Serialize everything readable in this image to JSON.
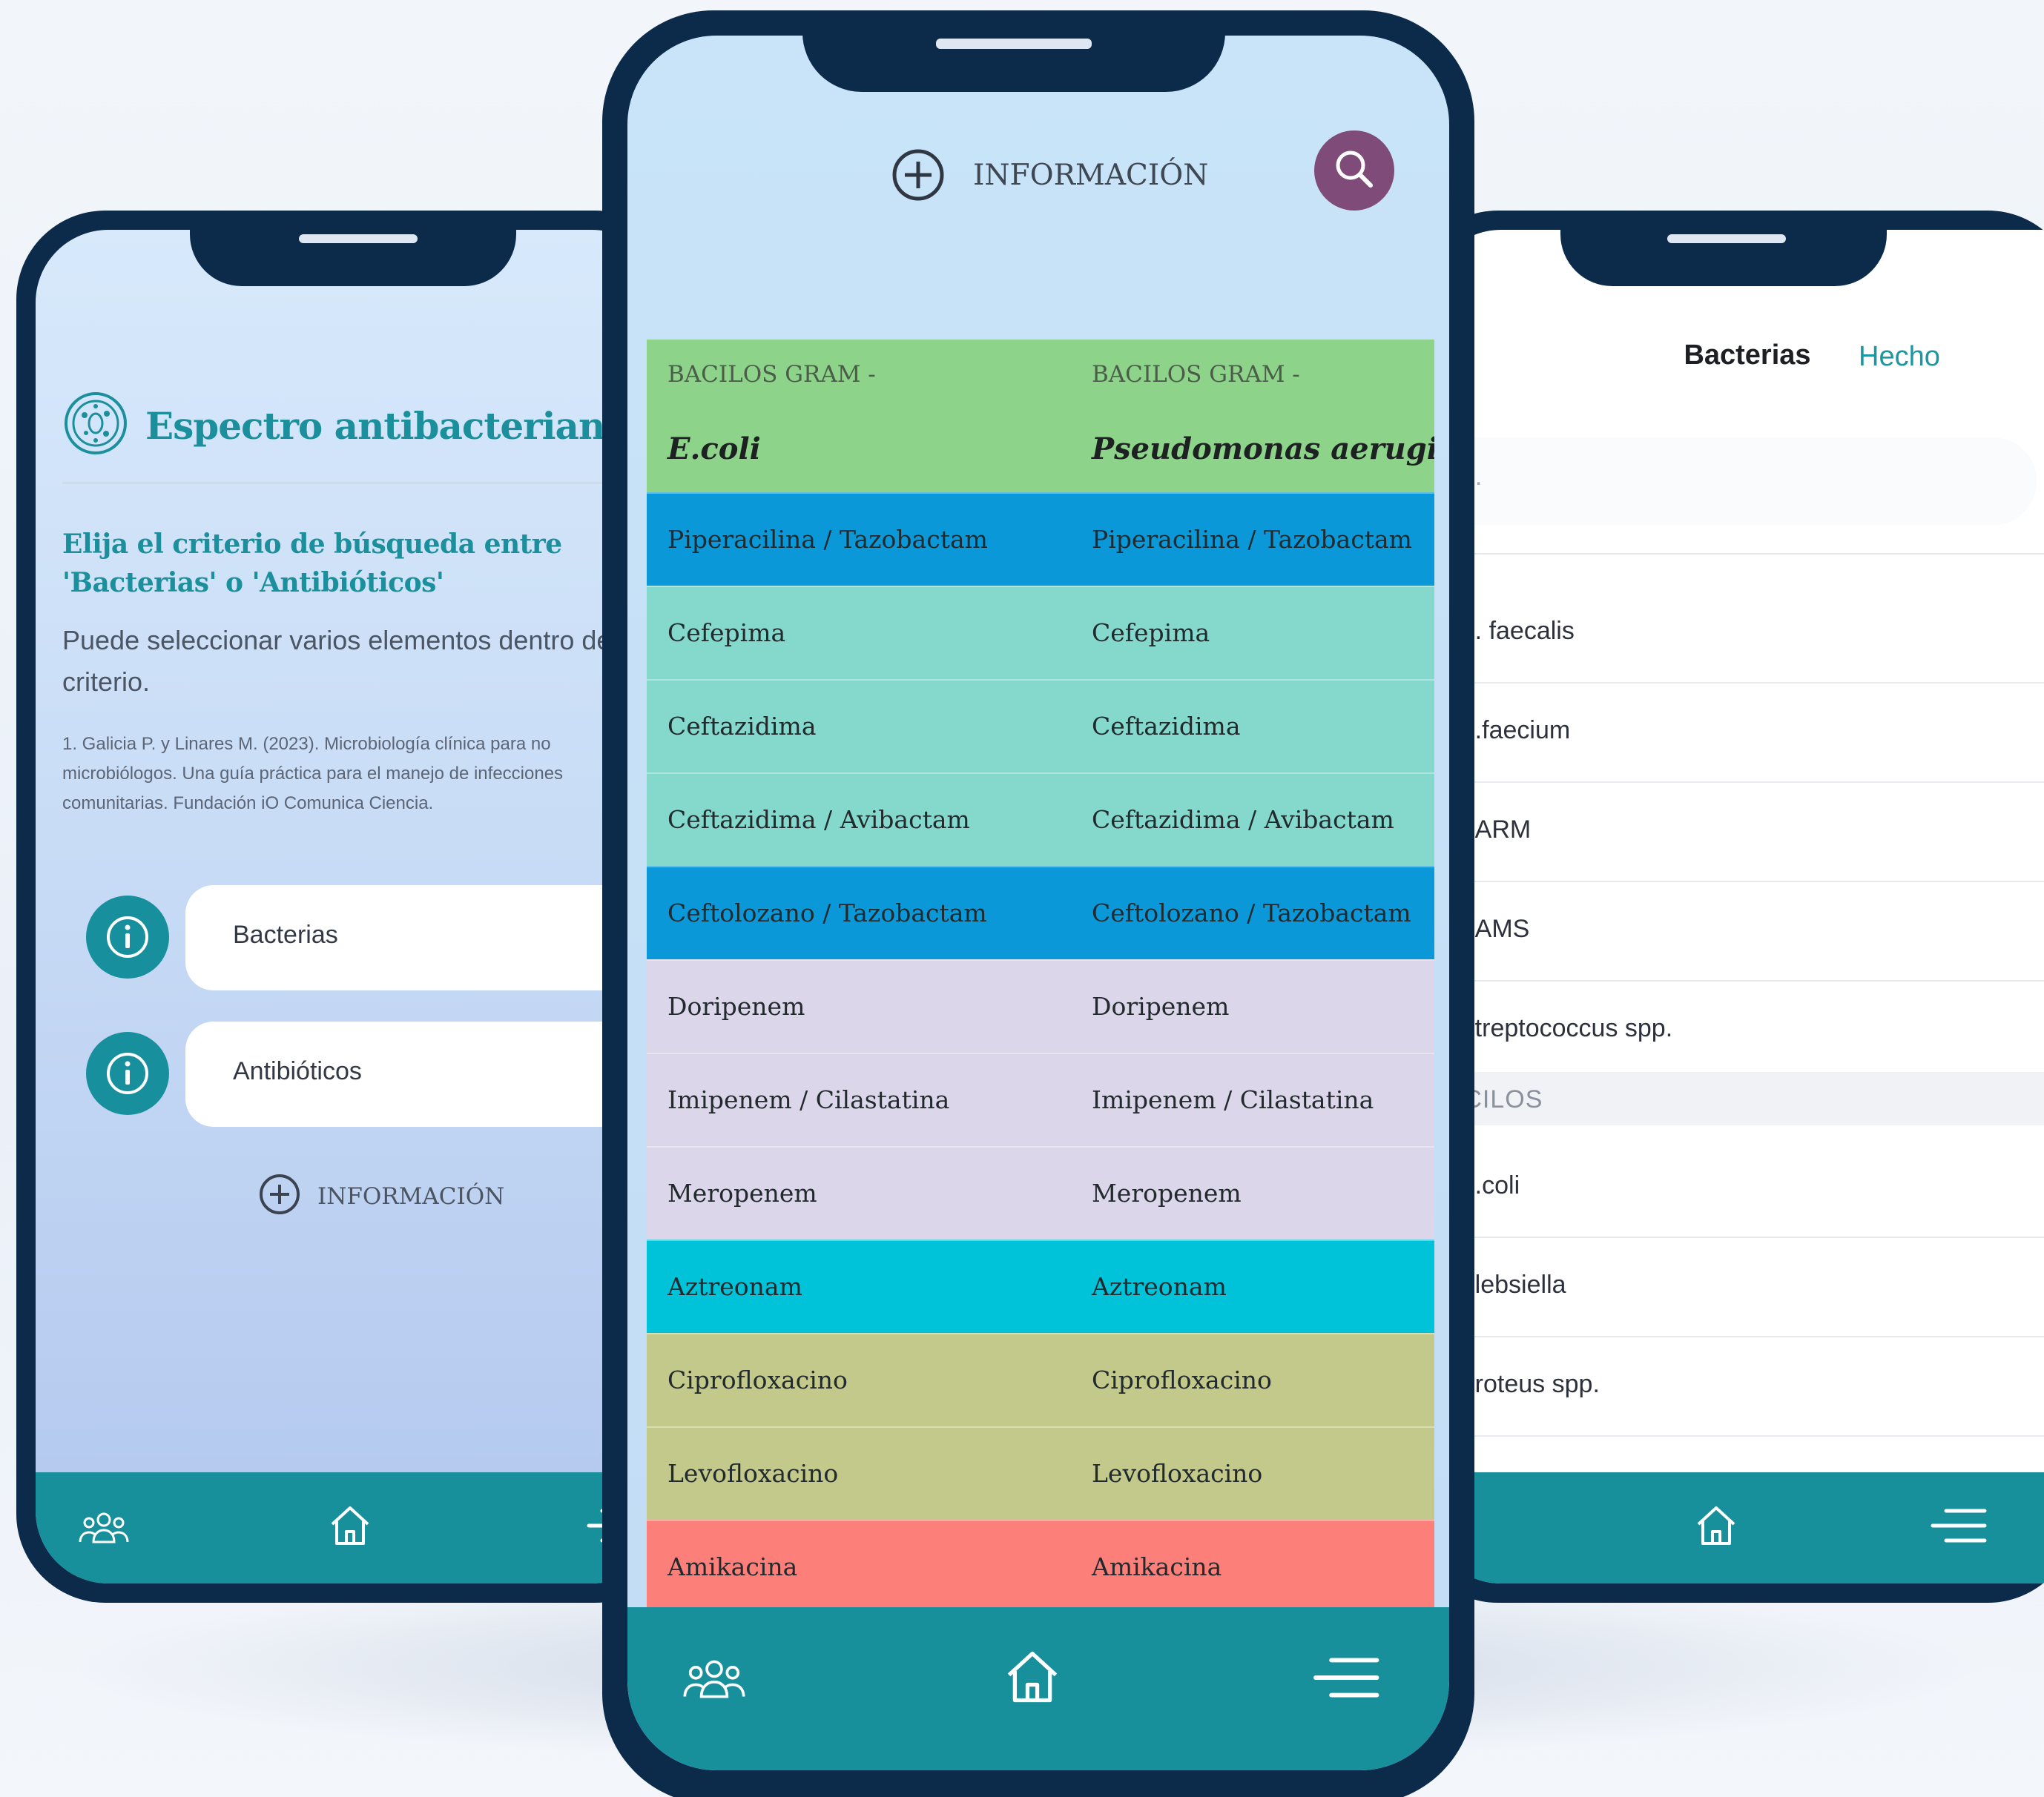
{
  "left": {
    "title": "Espectro antibacteriano",
    "title_sup": "1",
    "lead": "Elija el criterio de búsqueda entre 'Bacterias' o 'Antibióticos'",
    "description": "Puede seleccionar varios elementos dentro del criterio.",
    "reference": "1. Galicia P. y Linares M. (2023). Microbiología clínica para no microbiólogos. Una guía práctica para el manejo de infecciones comunitarias. Fundación iO Comunica Ciencia.",
    "options": [
      {
        "label": "Bacterias"
      },
      {
        "label": "Antibióticos"
      }
    ],
    "info_label": "INFORMACIÓN"
  },
  "center": {
    "info_label": "INFORMACIÓN",
    "columns": [
      {
        "group": "BACILOS GRAM -",
        "bacteria": "E.coli"
      },
      {
        "group": "BACILOS GRAM -",
        "bacteria": "Pseudomonas aeruginosa"
      }
    ],
    "rows": [
      {
        "c1": "Piperacilina / Tazobactam",
        "c2": "Piperacilina / Tazobactam",
        "color": "#0b98d8"
      },
      {
        "c1": "Cefepima",
        "c2": "Cefepima",
        "color": "#84d9cc"
      },
      {
        "c1": "Ceftazidima",
        "c2": "Ceftazidima",
        "color": "#84d9cc"
      },
      {
        "c1": "Ceftazidima / Avibactam",
        "c2": "Ceftazidima / Avibactam",
        "color": "#84d9cc"
      },
      {
        "c1": "Ceftolozano / Tazobactam",
        "c2": "Ceftolozano / Tazobactam",
        "color": "#0b98d8"
      },
      {
        "c1": "Doripenem",
        "c2": "Doripenem",
        "color": "#dbd6e9"
      },
      {
        "c1": "Imipenem / Cilastatina",
        "c2": "Imipenem / Cilastatina",
        "color": "#dbd6e9"
      },
      {
        "c1": "Meropenem",
        "c2": "Meropenem",
        "color": "#dbd6e9"
      },
      {
        "c1": "Aztreonam",
        "c2": "Aztreonam",
        "color": "#00c2d8"
      },
      {
        "c1": "Ciprofloxacino",
        "c2": "Ciprofloxacino",
        "color": "#c2c98b"
      },
      {
        "c1": "Levofloxacino",
        "c2": "Levofloxacino",
        "color": "#c2c98b"
      },
      {
        "c1": "Amikacina",
        "c2": "Amikacina",
        "color": "#fd7f7a"
      }
    ]
  },
  "right": {
    "title": "Bacterias",
    "done_label": "Hecho",
    "search_placeholder": "...",
    "items_top": [
      "E. faecalis",
      "E.faecium",
      "SARM",
      "SAMS",
      "Streptococcus spp."
    ],
    "section_label": "BACILOS",
    "items_bottom": [
      "E.coli",
      "Klebsiella",
      "Proteus spp."
    ]
  },
  "colors": {
    "frame": "#0c2a4a",
    "teal": "#17909b",
    "search_button": "#7f4c79",
    "header_green": "#8dd48a"
  },
  "icons": [
    "people-icon",
    "home-icon",
    "menu-icon",
    "search-icon",
    "plus-circle-icon",
    "info-icon",
    "chevron-right-icon",
    "bacteria-logo-icon"
  ]
}
